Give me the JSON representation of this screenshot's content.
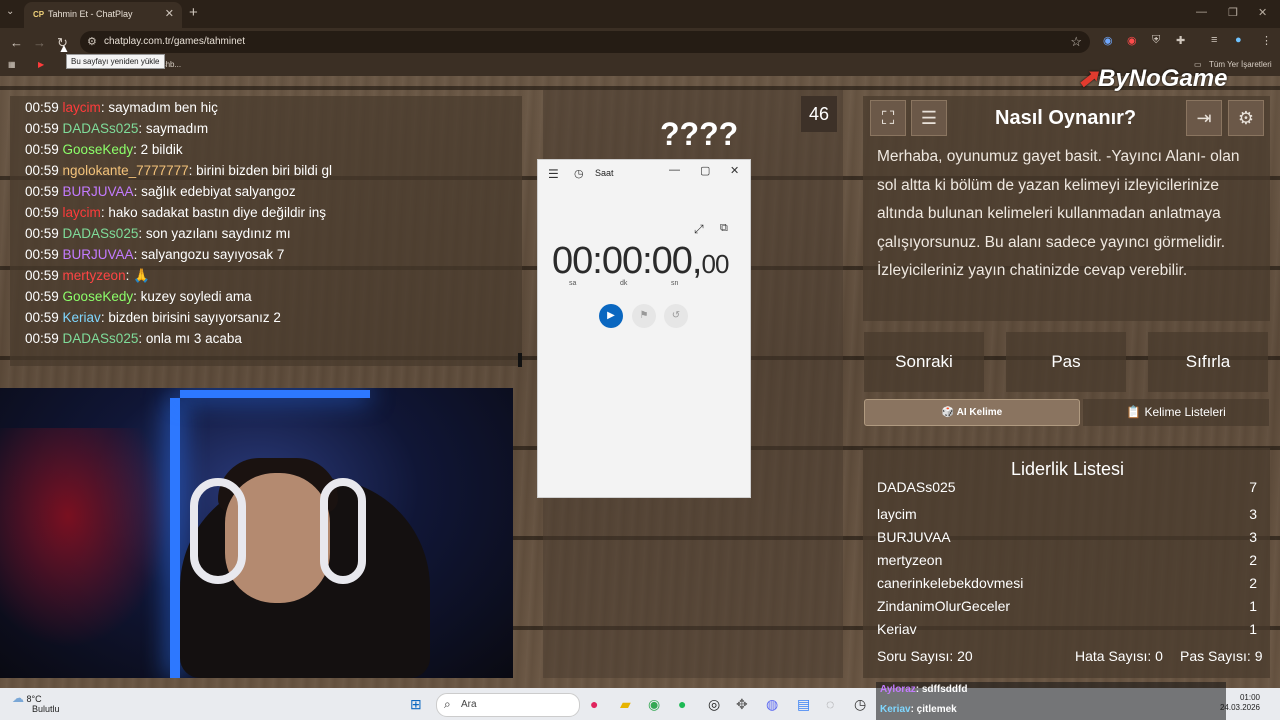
{
  "browser": {
    "tab_title": "Tahmin Et - ChatPlay",
    "tab_favicon": "CP",
    "url": "chatplay.com.tr/games/tahminet",
    "tooltip": "Bu sayfayı yeniden yükle",
    "bookmark_kick": "Kick Dashb...",
    "bookmark_all": "Tüm Yer İşaretleri"
  },
  "chat": {
    "messages": [
      {
        "time": "00:59",
        "user": "laycim",
        "color": "#ff3b3b",
        "text": ": saymadım ben hiç"
      },
      {
        "time": "00:59",
        "user": "DADASs025",
        "color": "#7fdc9a",
        "text": ": saymadım"
      },
      {
        "time": "00:59",
        "user": "GooseKedy",
        "color": "#8cff6a",
        "text": ": 2 bildik"
      },
      {
        "time": "00:59",
        "user": "ngolokante_7777777",
        "color": "#f3c27a",
        "text": ": birini bizden biri bildi gl"
      },
      {
        "time": "00:59",
        "user": "BURJUVAA",
        "color": "#c37bff",
        "text": ": sağlık edebiyat salyangoz"
      },
      {
        "time": "00:59",
        "user": "laycim",
        "color": "#ff3b3b",
        "text": ": hako sadakat bastın diye değildir inş"
      },
      {
        "time": "00:59",
        "user": "DADASs025",
        "color": "#7fdc9a",
        "text": ": son yazılanı saydınız mı"
      },
      {
        "time": "00:59",
        "user": "BURJUVAA",
        "color": "#c37bff",
        "text": ": salyangozu sayıyosak 7"
      },
      {
        "time": "00:59",
        "user": "mertyzeon",
        "color": "#ff4444",
        "text": ": 🙏"
      },
      {
        "time": "00:59",
        "user": "GooseKedy",
        "color": "#8cff6a",
        "text": ": kuzey soyledi ama"
      },
      {
        "time": "00:59",
        "user": "Keriav",
        "color": "#7fd7ff",
        "text": ": bizden birisini sayıyorsanız 2"
      },
      {
        "time": "00:59",
        "user": "DADASs025",
        "color": "#7fdc9a",
        "text": ": onla mı 3 acaba"
      }
    ]
  },
  "game": {
    "word": "????",
    "countdown": "46"
  },
  "clock_app": {
    "title": "Saat",
    "time_main": "00:00:00,",
    "time_ms": "00",
    "unit_h": "sa",
    "unit_m": "dk",
    "unit_s": "sn"
  },
  "howto": {
    "title": "Nasıl Oynanır?",
    "text": "Merhaba, oyunumuz gayet basit. -Yayıncı Alanı- olan sol altta ki bölüm de yazan kelimeyi izleyicilerinize altında bulunan kelimeleri kullanmadan anlatmaya çalışıyorsunuz. Bu alanı sadece yayıncı görmelidir. İzleyicileriniz yayın chatinizde cevap verebilir."
  },
  "controls": {
    "next": "Sonraki",
    "pass": "Pas",
    "reset": "Sıfırla",
    "ai_word": "🎲 AI Kelime",
    "word_lists": "📋 Kelime Listeleri"
  },
  "leaderboard": {
    "title": "Liderlik Listesi",
    "rows": [
      {
        "name": "DADASs025",
        "score": "7"
      },
      {
        "name": "laycim",
        "score": "3"
      },
      {
        "name": "BURJUVAA",
        "score": "3"
      },
      {
        "name": "mertyzeon",
        "score": "2"
      },
      {
        "name": "canerinkelebekdovmesi",
        "score": "2"
      },
      {
        "name": "ZindanimOlurGeceler",
        "score": "1"
      },
      {
        "name": "Keriav",
        "score": "1"
      }
    ],
    "question_count": "Soru Sayısı: 20",
    "wrong_count": "Hata Sayısı: 0",
    "pass_count": "Pas Sayısı: 9"
  },
  "brand": {
    "logo": "ByNoGame"
  },
  "overlay_chat": [
    {
      "user": "Ayloraz",
      "color": "#c37bff",
      "text": ": sdffsddfd"
    },
    {
      "user": "Keriav",
      "color": "#7fd7ff",
      "text": ": çitlemek"
    }
  ],
  "taskbar": {
    "temp": "8°C",
    "weather": "Bulutlu",
    "search_placeholder": "Ara",
    "time": "01:00",
    "date": "24.03.2026"
  }
}
